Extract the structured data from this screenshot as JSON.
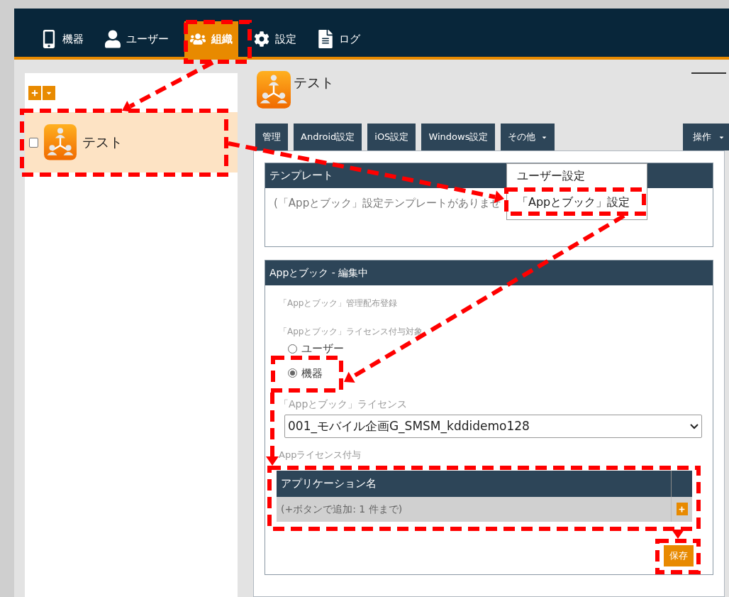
{
  "nav": [
    {
      "label": "機器",
      "selected": false
    },
    {
      "label": "ユーザー",
      "selected": false
    },
    {
      "label": "組織",
      "selected": true
    },
    {
      "label": "設定",
      "selected": false
    },
    {
      "label": "ログ",
      "selected": false
    }
  ],
  "tree": {
    "items": [
      {
        "label": "テスト",
        "checked": false,
        "selected": true
      }
    ]
  },
  "header": {
    "title": "テスト"
  },
  "tabs": [
    {
      "label": "管理",
      "kind": "tab"
    },
    {
      "label": "Android設定",
      "kind": "tab"
    },
    {
      "label": "iOS設定",
      "kind": "tab"
    },
    {
      "label": "Windows設定",
      "kind": "tab"
    },
    {
      "label": "その他",
      "kind": "menu"
    }
  ],
  "action_menu": {
    "label": "操作"
  },
  "dropdown_menu": {
    "items": [
      "ユーザー設定",
      "「Appとブック」設定"
    ]
  },
  "template_card": {
    "title": "テンプレート",
    "empty_text": "(「Appとブック」設定テンプレートがありませ"
  },
  "edit_card": {
    "title": "Appとブック - 編集中",
    "section_label": "「Appとブック」管理配布登録",
    "target_label": "「Appとブック」ライセンス付与対象",
    "radios": [
      {
        "label": "ユーザー",
        "selected": false
      },
      {
        "label": "機器",
        "selected": true
      }
    ],
    "license_label": "「Appとブック」ライセンス",
    "license_value": "001_モバイル企画G_SMSM_kddidemo128",
    "grant_label": "Appライセンス付与",
    "table": {
      "columns": [
        "アプリケーション名"
      ],
      "empty_text": "(+ボタンで追加: 1 件まで)"
    },
    "save_button": "保存"
  }
}
